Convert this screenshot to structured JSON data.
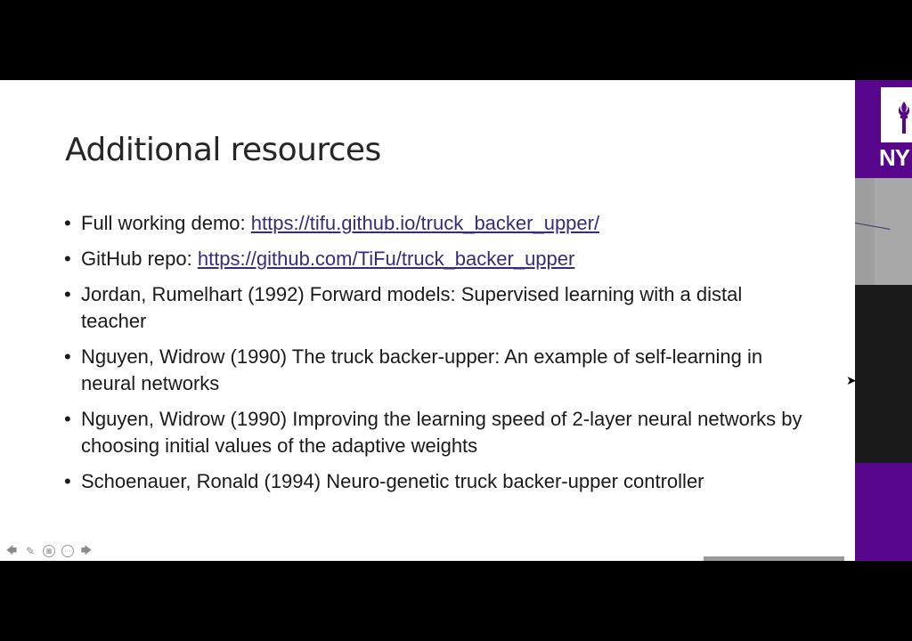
{
  "slide": {
    "title": "Additional resources",
    "items": [
      {
        "bullet": "•",
        "text": "Full working demo: ",
        "link": "https://tifu.github.io/truck_backer_upper/"
      },
      {
        "bullet": "•",
        "text": "GitHub repo: ",
        "link": "https://github.com/TiFu/truck_backer_upper"
      },
      {
        "bullet": "•",
        "text": "Jordan, Rumelhart (1992) Forward models: Supervised learning with a distal teacher",
        "link": ""
      },
      {
        "bullet": "•",
        "text": "Nguyen, Widrow (1990) The truck backer-upper: An example of self-learning in neural networks",
        "link": ""
      },
      {
        "bullet": "•",
        "text": "Nguyen, Widrow (1990) Improving the learning speed of 2-layer neural networks by choosing initial values of the adaptive weights",
        "link": ""
      },
      {
        "bullet": "•",
        "text": "Schoenauer, Ronald (1994) Neuro-genetic truck backer-upper controller",
        "link": ""
      }
    ]
  },
  "toolbar": {
    "icons": [
      "arrow-left-icon",
      "pen-icon",
      "slides-grid-icon",
      "more-icon",
      "arrow-right-icon"
    ],
    "glyphs": [
      "🡄",
      "✎",
      "▦",
      "⋯",
      "🡆"
    ]
  },
  "side_panel": {
    "logo_text": "NY"
  },
  "colors": {
    "brand_purple": "#57068c",
    "link": "#3a2a7a",
    "title": "#262626"
  }
}
